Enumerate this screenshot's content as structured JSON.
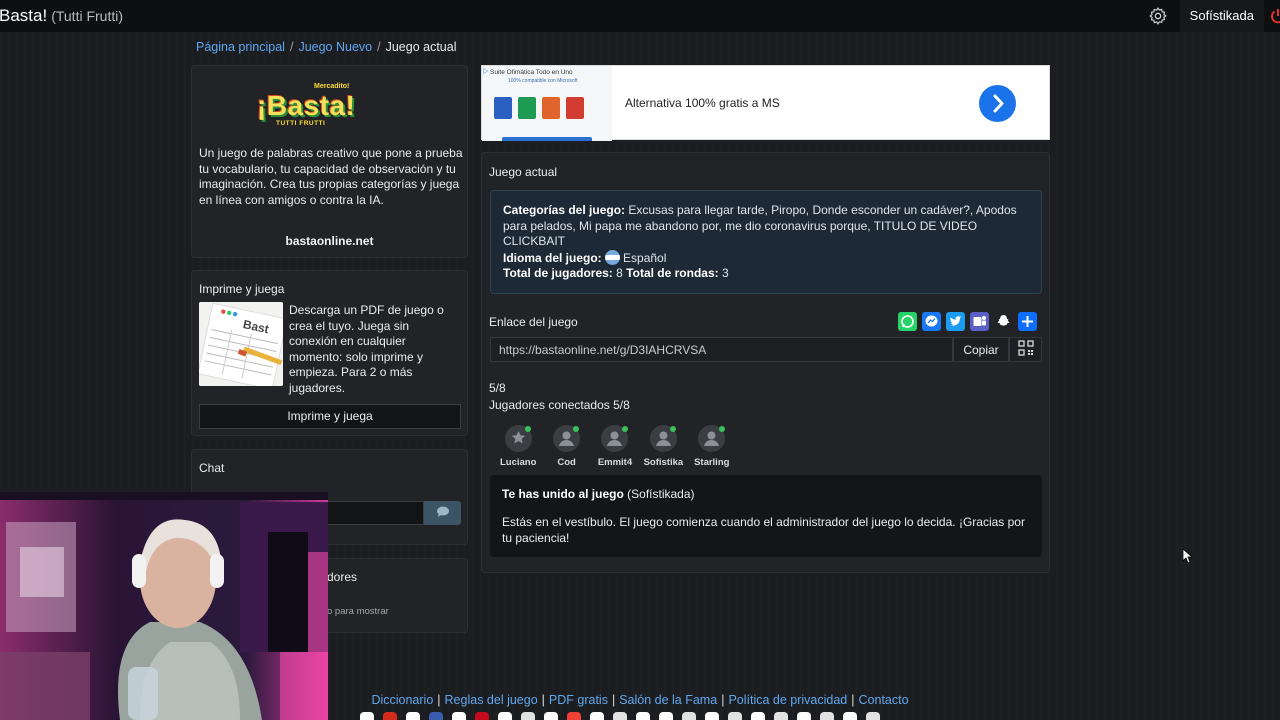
{
  "navbar": {
    "brand": "Basta!",
    "brand_sub": "(Tutti Frutti)",
    "user": "Sofístikada"
  },
  "breadcrumb": {
    "home": "Página principal",
    "new_game": "Juego Nuevo",
    "current": "Juego actual"
  },
  "about": {
    "logo_top": "Mercadito!",
    "logo_main": "¡Basta!",
    "logo_bottom": "TUTTI FRUTTI",
    "description": "Un juego de palabras creativo que pone a prueba tu vocabulario, tu capacidad de observación y tu imaginación. Crea tus propias categorías y juega en línea con amigos o contra la IA.",
    "site": "bastaonline.net"
  },
  "print": {
    "title": "Imprime y juega",
    "description": "Descarga un PDF de juego o crea el tuyo. Juega sin conexión en cualquier momento: solo imprime y empieza. Para 2 o más jugadores.",
    "button": "Imprime y juega"
  },
  "chat": {
    "title": "Chat",
    "input_value": ""
  },
  "players_card": {
    "title_partial": "dores",
    "hint_partial": "o para mostrar"
  },
  "ad": {
    "suite_title": "Suite Ofimática Todo en Uno",
    "suite_sub": "100% compatible con Microsoft",
    "text": "Alternativa 100% gratis a MS"
  },
  "game": {
    "title": "Juego actual",
    "categories_label": "Categorías del juego:",
    "categories": "Excusas para llegar tarde, Piropo, Donde esconder un cadáver?, Apodos para pelados, Mi papa me abandono por, me dio coronavirus porque, TITULO DE VIDEO CLICKBAIT",
    "language_label": "Idioma del juego:",
    "language": "Español",
    "players_label": "Total de jugadores:",
    "players": "8",
    "rounds_label": "Total de rondas:",
    "rounds": "3",
    "link_label": "Enlace del juego",
    "link": "https://bastaonline.net/g/D3IAHCRVSA",
    "copy": "Copiar",
    "count": "5/8",
    "connected": "Jugadores conectados 5/8",
    "avatars": [
      {
        "name": "Luciano"
      },
      {
        "name": "Cod"
      },
      {
        "name": "Emmit4"
      },
      {
        "name": "Sofistika"
      },
      {
        "name": "Starling"
      }
    ],
    "joined_bold": "Te has unido al juego",
    "joined_user": "(Sofístikada)",
    "lobby": "Estás en el vestíbulo. El juego comienza cuando el administrador del juego lo decida. ¡Gracias por tu paciencia!"
  },
  "footer": {
    "links": [
      "Diccionario",
      "Reglas del juego",
      "PDF gratis",
      "Salón de la Fama",
      "Política de privacidad",
      "Contacto"
    ]
  },
  "colors": {
    "background": "#1b1d20",
    "link": "#5fa8f0",
    "online": "#39c15a",
    "info_box": "#1d2a35"
  }
}
